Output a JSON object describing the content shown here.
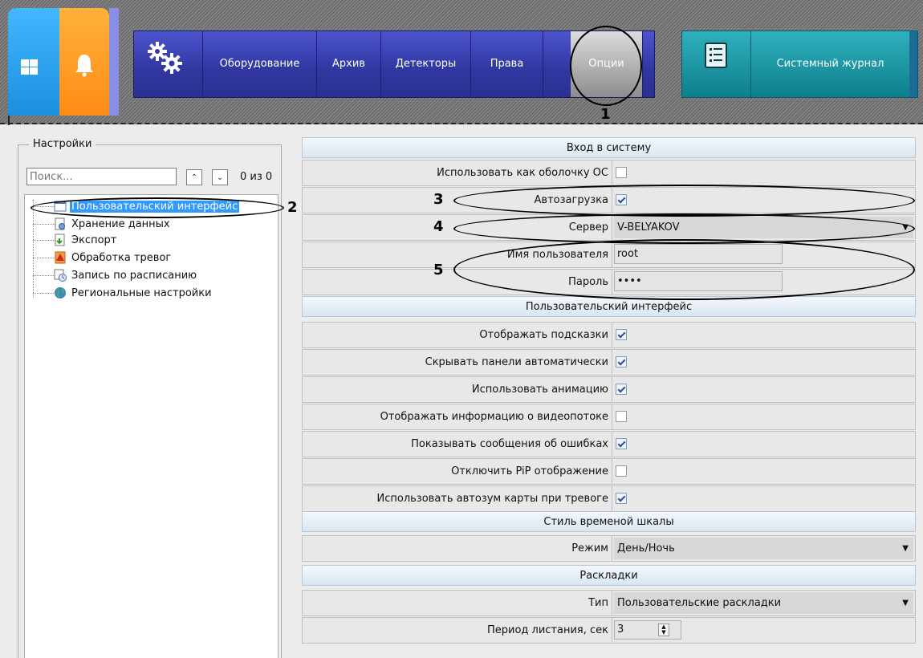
{
  "topbar": {
    "nav_items": [
      "Оборудование",
      "Архив",
      "Детекторы",
      "Права",
      "Опции"
    ],
    "journal_label": "Системный журнал",
    "icons": [
      "windows-icon",
      "bell-icon",
      "gears-icon",
      "journal-icon"
    ],
    "colors": {
      "blue_tile": "#1a8fe0",
      "orange_tile": "#ff8c16",
      "nav": "#3238a3",
      "journal": "#0f7f8c"
    }
  },
  "callouts": [
    "1",
    "2",
    "3",
    "4",
    "5"
  ],
  "settings": {
    "title": "Настройки",
    "search_placeholder": "Поиск...",
    "search_count": "0 из 0",
    "tree": [
      "Пользовательский интерфейс",
      "Хранение данных",
      "Экспорт",
      "Обработка тревог",
      "Запись по расписанию",
      "Региональные настройки"
    ]
  },
  "login": {
    "header": "Вход в систему",
    "use_as_shell": {
      "label": "Использовать как оболочку ОС",
      "checked": false
    },
    "autostart": {
      "label": "Автозагрузка",
      "checked": true
    },
    "server": {
      "label": "Сервер",
      "value": "V-BELYAKOV"
    },
    "username": {
      "label": "Имя пользователя",
      "value": "root"
    },
    "password": {
      "label": "Пароль",
      "value": "••••"
    }
  },
  "ui": {
    "header": "Пользовательский интерфейс",
    "options": [
      {
        "label": "Отображать подсказки",
        "checked": true
      },
      {
        "label": "Скрывать панели автоматически",
        "checked": true
      },
      {
        "label": "Использовать анимацию",
        "checked": true
      },
      {
        "label": "Отображать информацию о видеопотоке",
        "checked": false
      },
      {
        "label": "Показывать сообщения об ошибках",
        "checked": true
      },
      {
        "label": "Отключить PiP отображение",
        "checked": false
      },
      {
        "label": "Использовать автозум карты при тревоге",
        "checked": true
      }
    ]
  },
  "timeline": {
    "header": "Стиль временой шкалы",
    "mode": {
      "label": "Режим",
      "value": "День/Ночь"
    }
  },
  "layouts": {
    "header": "Раскладки",
    "type": {
      "label": "Тип",
      "value": "Пользовательские раскладки"
    },
    "period": {
      "label": "Период листания, сек",
      "value": "3"
    }
  }
}
